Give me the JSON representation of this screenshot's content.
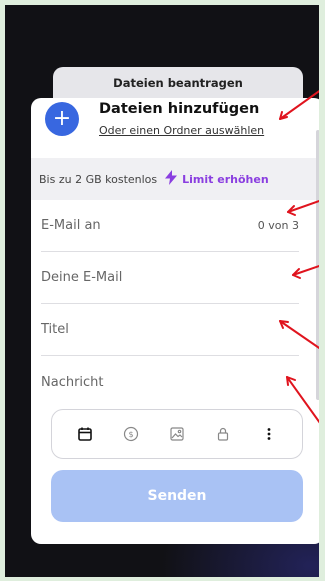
{
  "request_tab": {
    "label": "Dateien beantragen"
  },
  "upload": {
    "add_icon": "+",
    "title": "Dateien hinzufügen",
    "folder_link": "Oder einen Ordner auswählen"
  },
  "limit": {
    "text": "Bis zu 2 GB kostenlos",
    "bolt_icon": "bolt-icon",
    "link": "Limit erhöhen"
  },
  "form": {
    "email_to": {
      "placeholder": "E-Mail an",
      "count": "0 von 3"
    },
    "your_email": {
      "placeholder": "Deine E-Mail"
    },
    "title": {
      "placeholder": "Titel"
    },
    "message": {
      "placeholder": "Nachricht"
    }
  },
  "toolbar": {
    "icons": [
      "calendar-icon",
      "dollar-icon",
      "image-icon",
      "lock-icon",
      "more-icon"
    ]
  },
  "send_button": {
    "label": "Senden"
  },
  "colors": {
    "accent_blue": "#3867e0",
    "send_disabled": "#a9c2f4",
    "limit_purple": "#8a3ee0",
    "annotation_red": "#e0141e"
  }
}
